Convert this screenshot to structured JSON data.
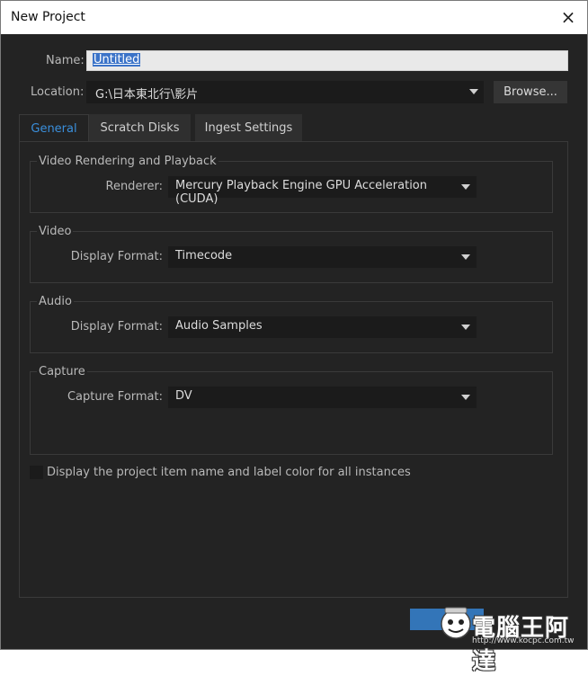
{
  "window": {
    "title": "New Project",
    "close_glyph": "×"
  },
  "form": {
    "name_label": "Name:",
    "name_value": "Untitled",
    "location_label": "Location:",
    "location_value": "G:\\日本東北行\\影片",
    "browse_label": "Browse..."
  },
  "tabs": [
    {
      "label": "General",
      "active": true
    },
    {
      "label": "Scratch Disks",
      "active": false
    },
    {
      "label": "Ingest Settings",
      "active": false
    }
  ],
  "general": {
    "video_rendering": {
      "title": "Video Rendering and Playback",
      "renderer_label": "Renderer:",
      "renderer_value": "Mercury Playback Engine GPU Acceleration (CUDA)"
    },
    "video": {
      "title": "Video",
      "display_format_label": "Display Format:",
      "display_format_value": "Timecode"
    },
    "audio": {
      "title": "Audio",
      "display_format_label": "Display Format:",
      "display_format_value": "Audio Samples"
    },
    "capture": {
      "title": "Capture",
      "capture_format_label": "Capture Format:",
      "capture_format_value": "DV"
    },
    "checkbox_label": "Display the project item name and label color for all instances",
    "checkbox_checked": false
  },
  "watermark": {
    "brand_text": "電腦王阿達",
    "url_text": "http://www.kocpc.com.tw"
  },
  "colors": {
    "accent": "#3a8fdc",
    "primary_button": "#3375b8",
    "panel_bg": "#232323",
    "field_bg": "#1b1b1b"
  }
}
